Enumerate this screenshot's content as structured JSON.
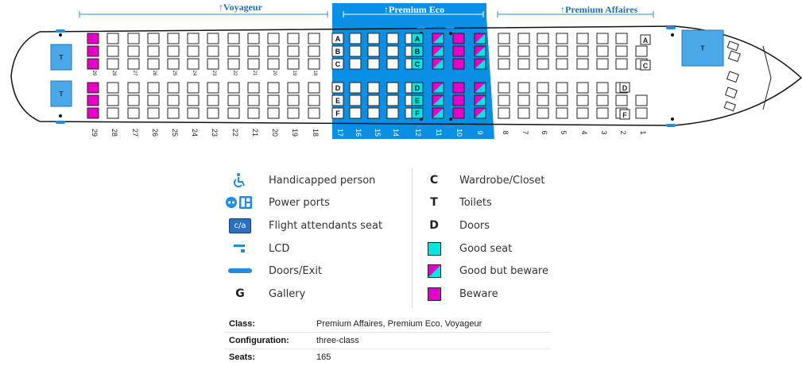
{
  "cabins": [
    {
      "name": "Voyageur"
    },
    {
      "name": "Premium Eco"
    },
    {
      "name": "Premium Affaires"
    }
  ],
  "seat_rows": {
    "voyageur": [
      "29",
      "28",
      "27",
      "26",
      "25",
      "24",
      "23",
      "22",
      "21",
      "20",
      "19",
      "18"
    ],
    "premium_eco": [
      "17",
      "16",
      "15",
      "14",
      "12",
      "11",
      "10",
      "9"
    ],
    "premium_affaires": [
      "8",
      "7",
      "6",
      "5",
      "4",
      "3",
      "2",
      "1"
    ]
  },
  "seat_letters": [
    "A",
    "B",
    "C",
    "D",
    "E",
    "F"
  ],
  "facility_labels": {
    "toilet": "T",
    "wardrobe": "C",
    "door": "D"
  },
  "legend": {
    "left": [
      {
        "icon": "wheelchair-icon",
        "label": "Handicapped person"
      },
      {
        "icon": "power-port-icon",
        "label": "Power ports"
      },
      {
        "icon": "flight-attendant-seat-icon",
        "icon_text": "c/a",
        "label": "Flight attendants seat"
      },
      {
        "icon": "lcd-icon",
        "label": "LCD"
      },
      {
        "icon": "door-exit-icon",
        "label": "Doors/Exit"
      },
      {
        "icon": "gallery-icon",
        "icon_text": "G",
        "label": "Gallery"
      }
    ],
    "right": [
      {
        "icon": "wardrobe-icon",
        "icon_text": "C",
        "label": "Wardrobe/Closet"
      },
      {
        "icon": "toilet-icon",
        "icon_text": "T",
        "label": "Toilets"
      },
      {
        "icon": "door-icon",
        "icon_text": "D",
        "label": "Doors"
      },
      {
        "icon": "good-seat-swatch",
        "label": "Good seat"
      },
      {
        "icon": "beware-split-swatch",
        "label": "Good but beware"
      },
      {
        "icon": "beware-seat-swatch",
        "label": "Beware"
      }
    ]
  },
  "specs": [
    {
      "key": "Class:",
      "value": "Premium Affaires, Premium Eco, Voyageur"
    },
    {
      "key": "Configuration:",
      "value": "three-class"
    },
    {
      "key": "Seats:",
      "value": "165"
    }
  ],
  "colors": {
    "good": "#00e5e5",
    "beware": "#e600c8",
    "accent_blue": "#1e8fe0",
    "premium_eco_band": "#0a8fe6",
    "outline": "#222222"
  }
}
